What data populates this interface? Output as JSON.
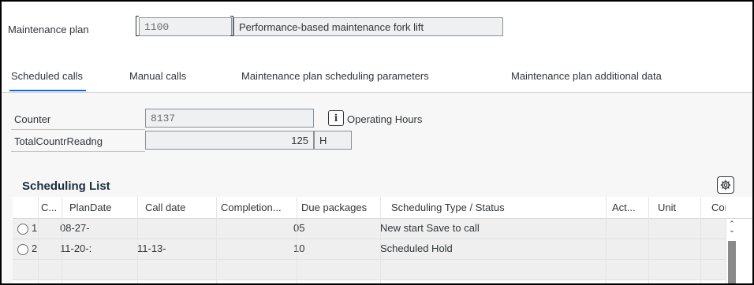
{
  "header": {
    "maintenance_plan_label": "Maintenance plan",
    "maintenance_plan_value": "1100",
    "maintenance_plan_description": "Performance-based maintenance fork lift"
  },
  "tabs": [
    {
      "label": "Scheduled calls",
      "active": true
    },
    {
      "label": "Manual calls",
      "active": false
    },
    {
      "label": "Maintenance plan scheduling parameters",
      "active": false
    },
    {
      "label": "Maintenance plan additional data",
      "active": false
    }
  ],
  "counter": {
    "label": "Counter",
    "value": "8137",
    "info_icon": "info-icon",
    "unit_text": "Operating Hours"
  },
  "total_counter": {
    "label": "TotalCountrReadng",
    "value": "125",
    "unit": "H"
  },
  "scheduling_list": {
    "title": "Scheduling List",
    "settings_icon": "gear-icon",
    "columns": [
      "C...",
      "PlanDate",
      "Call date",
      "Completion...",
      "Due packages",
      "Scheduling Type / Status",
      "Act...",
      "Unit",
      "Cor"
    ],
    "rows": [
      {
        "c": "1",
        "plan_date": "08-27-",
        "call_date": "",
        "completion": "",
        "due_packages": "05",
        "status": "New start  Save to call",
        "act": "",
        "unit": "",
        "cor": ""
      },
      {
        "c": "2",
        "plan_date": "11-20-:",
        "call_date": "11-13-",
        "completion": "",
        "due_packages": "10",
        "status": "Scheduled  Hold",
        "act": "",
        "unit": "",
        "cor": ""
      }
    ]
  },
  "colors": {
    "active_tab_underline": "#0a6ed1",
    "field_background": "#eef0f1",
    "row_background": "#efefef"
  }
}
